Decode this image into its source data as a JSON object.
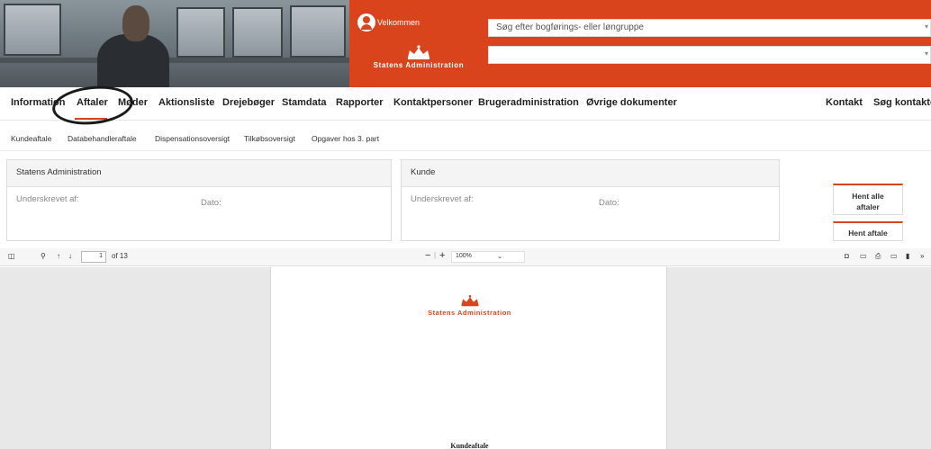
{
  "header": {
    "welcome": "Velkommen",
    "brand": "Statens Administration",
    "search_primary": "Søg efter bogførings- eller løngruppe",
    "search_secondary": ""
  },
  "mainnav": {
    "items": [
      "Information",
      "Aftaler",
      "Møder",
      "Aktionsliste",
      "Drejebøger",
      "Stamdata",
      "Rapporter",
      "Kontaktpersoner",
      "Brugeradministration",
      "Øvrige dokumenter"
    ],
    "right_items": [
      "Kontakt",
      "Søg kontakter"
    ],
    "active": "Aftaler"
  },
  "subnav": {
    "items": [
      "Kundeaftale",
      "Databehandleraftale",
      "Dispensationsoversigt",
      "Tilkøbsoversigt",
      "Opgaver hos 3. part"
    ]
  },
  "panel_left": {
    "title": "Statens Administration",
    "signed_by": "Underskrevet af:",
    "date": "Dato:"
  },
  "panel_right": {
    "title": "Kunde",
    "signed_by": "Underskrevet af:",
    "date": "Dato:"
  },
  "buttons": {
    "fetch_all": "Hent alle aftaler",
    "fetch": "Hent aftale"
  },
  "pdf": {
    "page_current": "1",
    "page_total": "of 13",
    "zoom": "100%",
    "logo_text": "Statens Administration",
    "doc_title": "Kundeaftale"
  },
  "colors": {
    "brand": "#d9441c"
  }
}
